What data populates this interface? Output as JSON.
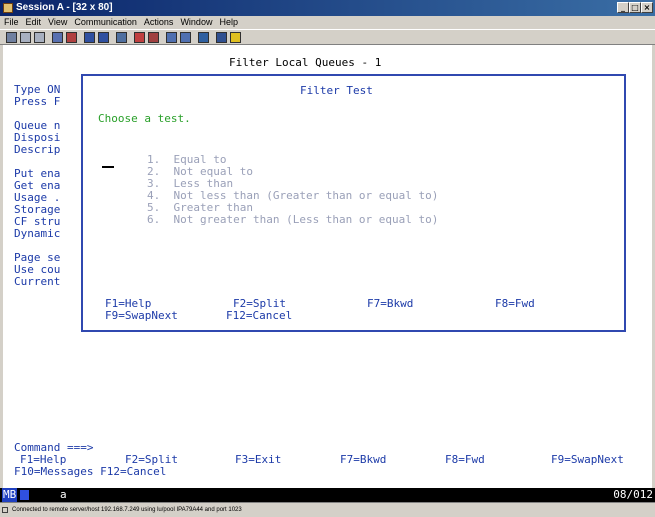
{
  "window": {
    "title": "Session A - [32 x 80]",
    "min": "_",
    "max": "□",
    "close": "×"
  },
  "menu": [
    "File",
    "Edit",
    "View",
    "Communication",
    "Actions",
    "Window",
    "Help"
  ],
  "screen": {
    "header": "Filter Local Queues - 1",
    "left_fields": [
      "Type ON",
      "Press F",
      "",
      "Queue n",
      "Disposi",
      "Descrip",
      "",
      "Put ena",
      "Get ena",
      "Usage .",
      "Storage",
      "CF stru",
      "Dynamic",
      "",
      "Page se",
      "Use cou",
      "Current"
    ],
    "dialog": {
      "title": "Filter Test",
      "prompt": "Choose a test.",
      "options": [
        "1.  Equal to",
        "2.  Not equal to",
        "3.  Less than",
        "4.  Not less than (Greater than or equal to)",
        "5.  Greater than",
        "6.  Not greater than (Less than or equal to)"
      ],
      "fkeys_row1": [
        "F1=Help",
        "F2=Split",
        "F7=Bkwd",
        "F8=Fwd"
      ],
      "fkeys_row2": [
        "F9=SwapNext",
        "F12=Cancel"
      ]
    },
    "command_label": "Command ===>",
    "fkeys_row1": [
      "F1=Help",
      "F2=Split",
      "F3=Exit",
      "F7=Bkwd",
      "F8=Fwd",
      "F9=SwapNext"
    ],
    "fkeys_row2": "F10=Messages F12=Cancel"
  },
  "status": {
    "mode": "MB",
    "input": "a",
    "position": "08/012"
  },
  "footer": "Connected to remote server/host 192.168.7.249 using lu/pool IPA79A44 and port 1023"
}
